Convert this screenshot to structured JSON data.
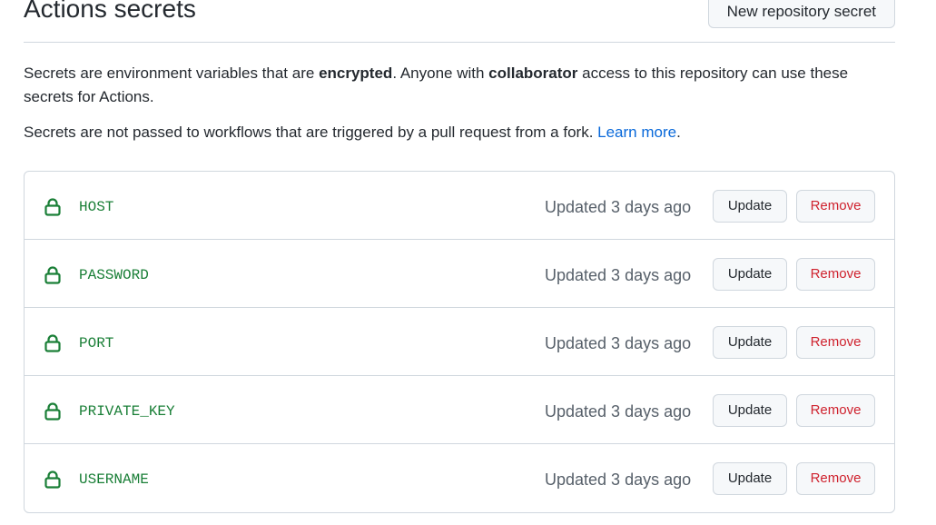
{
  "header": {
    "title": "Actions secrets",
    "new_button_label": "New repository secret"
  },
  "description": {
    "p1_part1": "Secrets are environment variables that are ",
    "p1_bold1": "encrypted",
    "p1_part2": ". Anyone with ",
    "p1_bold2": "collaborator",
    "p1_part3": " access to this repository can use these secrets for Actions.",
    "p2_text": "Secrets are not passed to workflows that are triggered by a pull request from a fork. ",
    "p2_link": "Learn more",
    "p2_end": "."
  },
  "icons": {
    "lock": "lock-icon",
    "lock_color": "#1a7f37"
  },
  "secrets": [
    {
      "name": "HOST",
      "updated": "Updated 3 days ago",
      "update_label": "Update",
      "remove_label": "Remove"
    },
    {
      "name": "PASSWORD",
      "updated": "Updated 3 days ago",
      "update_label": "Update",
      "remove_label": "Remove"
    },
    {
      "name": "PORT",
      "updated": "Updated 3 days ago",
      "update_label": "Update",
      "remove_label": "Remove"
    },
    {
      "name": "PRIVATE_KEY",
      "updated": "Updated 3 days ago",
      "update_label": "Update",
      "remove_label": "Remove"
    },
    {
      "name": "USERNAME",
      "updated": "Updated 3 days ago",
      "update_label": "Update",
      "remove_label": "Remove"
    }
  ]
}
